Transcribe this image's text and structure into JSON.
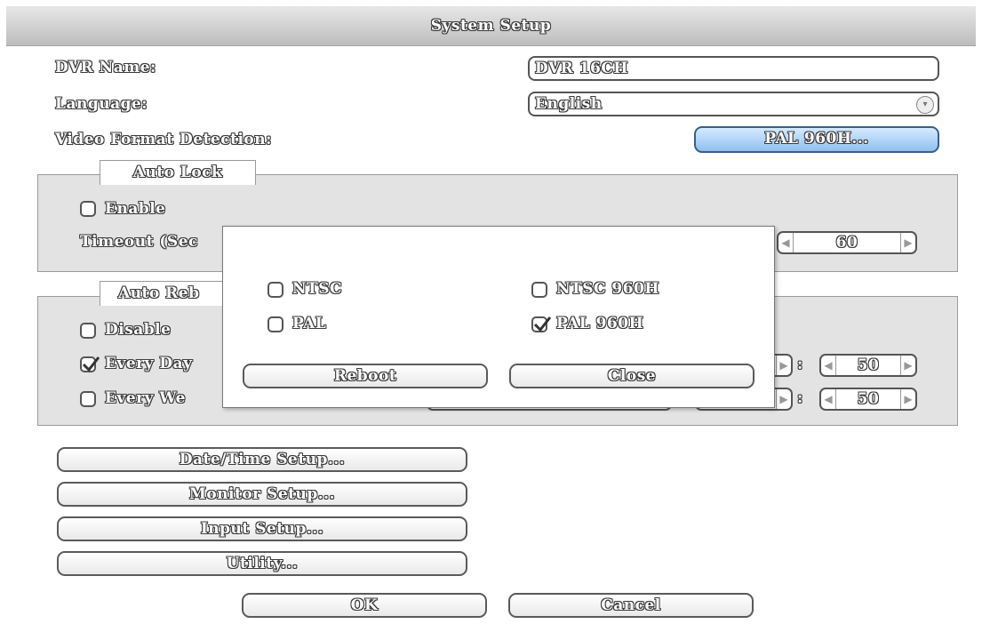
{
  "window": {
    "title": "System Setup"
  },
  "settings": {
    "dvr_name_label": "DVR Name:",
    "dvr_name_value": "DVR 16CH",
    "language_label": "Language:",
    "language_value": "English",
    "video_format_label": "Video Format Detection:",
    "video_format_value": "PAL 960H..."
  },
  "auto_lock": {
    "tab_label": "Auto Lock",
    "enable_label": "Enable",
    "enable_checked": false,
    "timeout_label": "Timeout (Sec",
    "timeout_value": "60"
  },
  "auto_reboot": {
    "tab_label": "Auto Reb",
    "disable_label": "Disable",
    "disable_checked": false,
    "every_day_label": "Every Day",
    "every_day_checked": true,
    "every_day_minute": "50",
    "every_week_label": "Every We",
    "every_week_checked": false,
    "every_week_minute": "50",
    "separator": ":"
  },
  "buttons": {
    "date_time": "Date/Time Setup...",
    "monitor": "Monitor Setup...",
    "input": "Input Setup...",
    "utility": "Utility...",
    "ok": "OK",
    "cancel": "Cancel"
  },
  "video_dialog": {
    "options": [
      {
        "label": "NTSC",
        "checked": false
      },
      {
        "label": "NTSC 960H",
        "checked": false
      },
      {
        "label": "PAL",
        "checked": false
      },
      {
        "label": "PAL 960H",
        "checked": true
      }
    ],
    "reboot_label": "Reboot",
    "close_label": "Close"
  },
  "colors": {
    "selected_button": "#8fc0f0",
    "group_bg": "#e3e3e3",
    "titlebar": "#cfcfcf"
  }
}
